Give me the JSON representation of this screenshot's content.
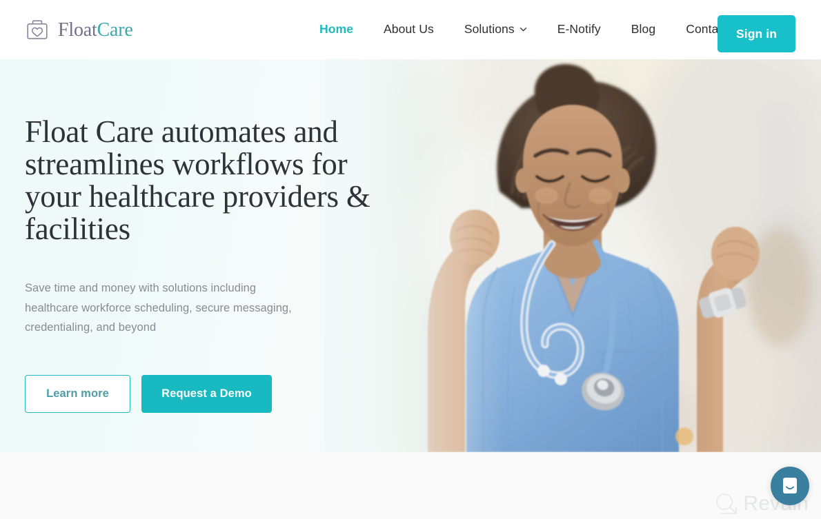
{
  "brand": {
    "name_part1": "Float",
    "name_part2": "Care",
    "icon": "shopping-bag-heart-icon"
  },
  "nav": {
    "items": [
      {
        "label": "Home",
        "active": true
      },
      {
        "label": "About Us",
        "active": false
      },
      {
        "label": "Solutions",
        "active": false,
        "icon": "chevron-down-icon"
      },
      {
        "label": "E-Notify",
        "active": false
      },
      {
        "label": "Blog",
        "active": false
      },
      {
        "label": "Contact",
        "active": false
      }
    ],
    "signin_label": "Sign in"
  },
  "hero": {
    "headline": "Float Care automates and streamlines workflows for your healthcare providers & facilities",
    "subhead": "Save time and money with  solutions including healthcare workforce scheduling, secure messaging, credentialing, and beyond",
    "cta_primary": "Request a Demo",
    "cta_secondary": "Learn more",
    "image_alt": "Smiling healthcare worker in blue scrubs with a stethoscope raising both fists in celebration"
  },
  "watermark": {
    "text": "Revain",
    "icon": "revain-logo-icon"
  },
  "chat": {
    "icon": "intercom-chat-icon",
    "label": "Open chat"
  },
  "colors": {
    "accent": "#18c0c9",
    "accent_dark": "#20b9bd",
    "brand_word1": "#6e7188",
    "brand_word2": "#3aa8ad",
    "headline": "#2e3338",
    "body_text": "#878c92",
    "nav_text": "#2f2f33",
    "hero_bg": "#eefaf8",
    "page_bg": "#fafafa",
    "chat_bubble": "#3b7f9e",
    "scrubs_blue": "#79a8d8"
  }
}
